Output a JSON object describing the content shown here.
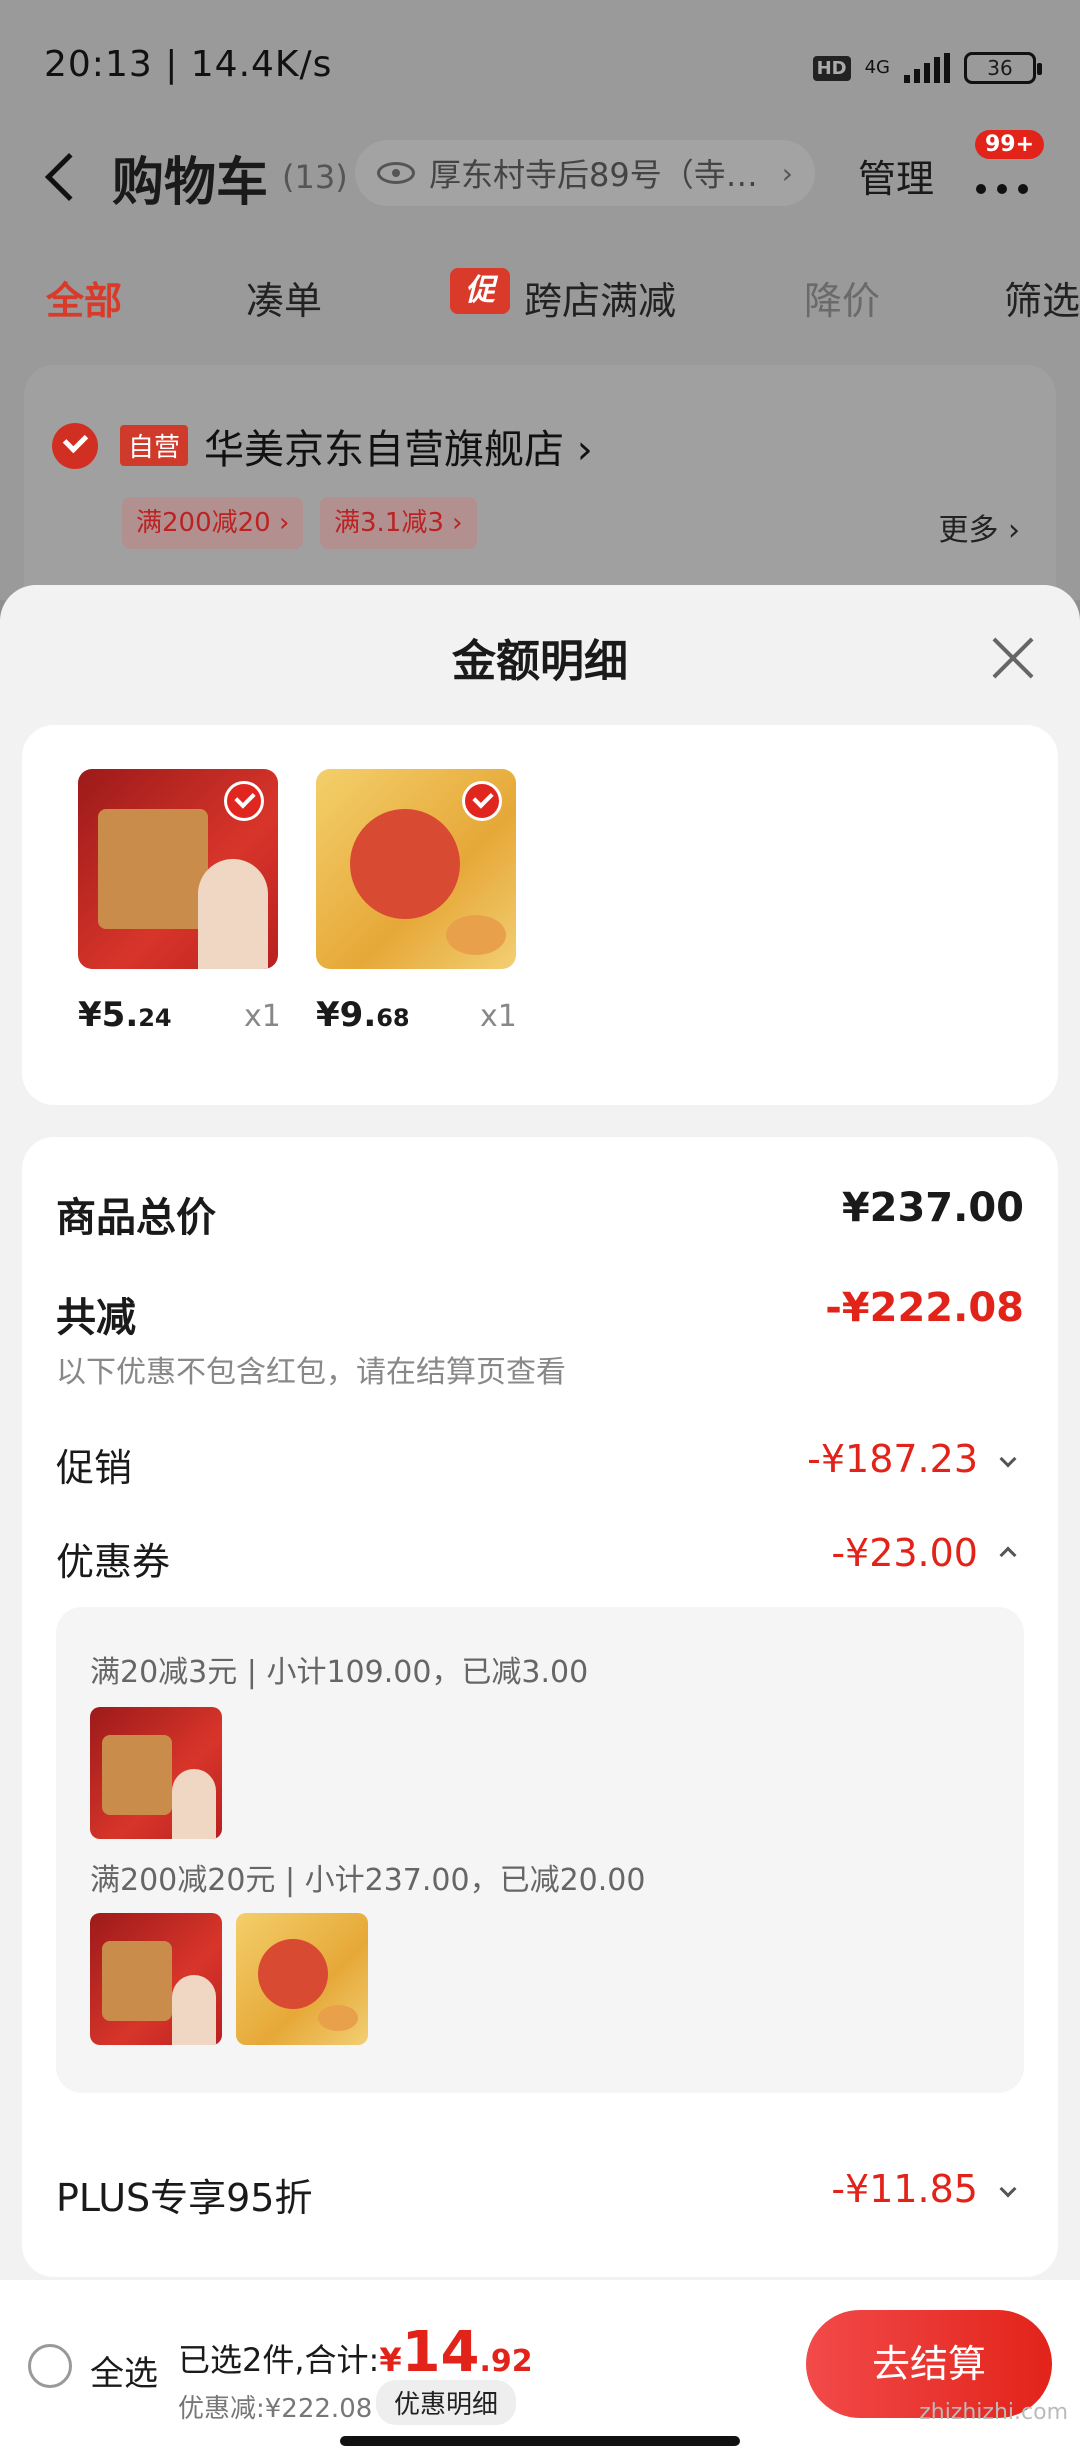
{
  "status": {
    "time": "20:13 | 14.4K/s",
    "hd": "HD",
    "net": "4G",
    "battery": "36"
  },
  "header": {
    "title": "购物车",
    "count": "(13)",
    "address": "厚东村寺后89号（寺…",
    "manage": "管理",
    "badge": "99+"
  },
  "tabs": [
    {
      "label": "全部",
      "active": true
    },
    {
      "label": "凑单"
    },
    {
      "label": "跨店满减",
      "icon": "促"
    },
    {
      "label": "降价",
      "faded": true
    },
    {
      "label": "筛选"
    }
  ],
  "store": {
    "self_badge": "自营",
    "name": "华美京东自营旗舰店 ›",
    "promos": [
      "满200减20 ›",
      "满3.1减3 ›"
    ],
    "more": "更多 ›"
  },
  "sheet": {
    "title": "金额明细",
    "products": [
      {
        "price_int": "¥5.",
        "price_dec": "24",
        "qty": "x1",
        "image": "red-mooncake-giftbox"
      },
      {
        "price_int": "¥9.",
        "price_dec": "68",
        "qty": "x1",
        "image": "gold-mooncake-giftbox"
      }
    ],
    "total_label": "商品总价",
    "total_value": "¥237.00",
    "reduce_label": "共减",
    "reduce_value": "-¥222.08",
    "reduce_note": "以下优惠不包含红包，请在结算页查看",
    "promo_label": "促销",
    "promo_value": "-¥187.23",
    "coupon_label": "优惠券",
    "coupon_value": "-¥23.00",
    "coupons": [
      {
        "text": "满20减3元 | 小计109.00，已减3.00"
      },
      {
        "text": "满200减20元 | 小计237.00，已减20.00"
      }
    ],
    "plus_label": "PLUS专享95折",
    "plus_value": "-¥11.85"
  },
  "bottom": {
    "select_all": "全选",
    "summary_prefix": "已选2件,合计:",
    "currency": "¥",
    "total_int": "14",
    "total_dec": ".92",
    "discount": "优惠减:¥222.08",
    "detail_button": "优惠明细",
    "checkout": "去结算"
  },
  "watermark": "zhizhizhi.com",
  "colors": {
    "accent": "#e2231a",
    "dim": "#9a9a9a"
  }
}
